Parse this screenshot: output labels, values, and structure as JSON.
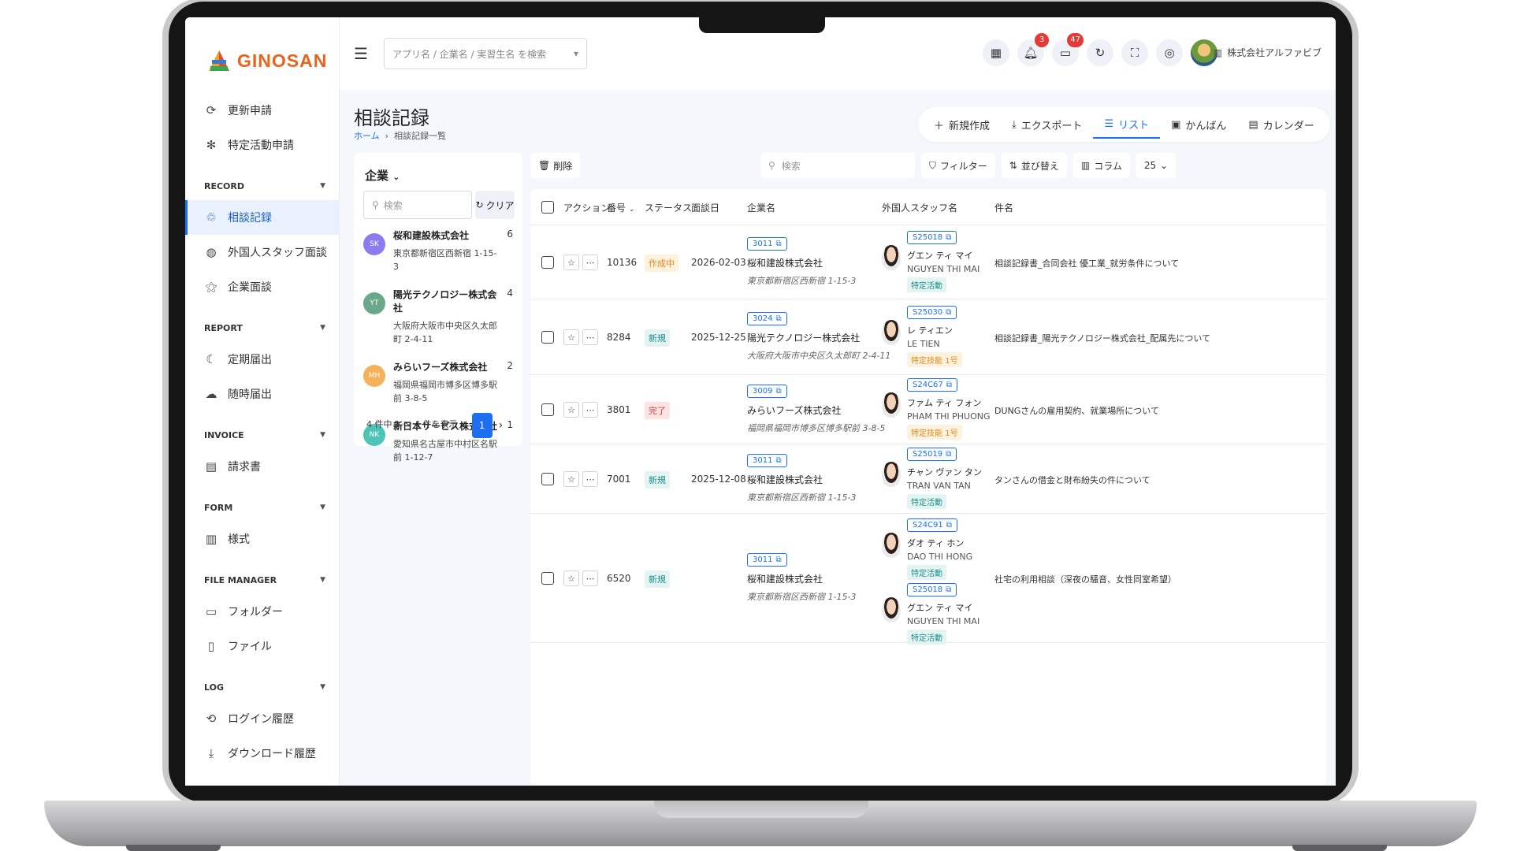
{
  "app": {
    "logo_text": "GINOSAN"
  },
  "sidebar": {
    "top_items": [
      {
        "label": "更新申請",
        "icon": "refresh-icon"
      },
      {
        "label": "特定活動申請",
        "icon": "snowflake-icon"
      }
    ],
    "sections": [
      {
        "title": "RECORD",
        "items": [
          {
            "label": "相談記録",
            "icon": "recycle-icon",
            "active": true
          },
          {
            "label": "外国人スタッフ面談",
            "icon": "globe-icon"
          },
          {
            "label": "企業面談",
            "icon": "wand-icon"
          }
        ]
      },
      {
        "title": "REPORT",
        "items": [
          {
            "label": "定期届出",
            "icon": "moon-icon"
          },
          {
            "label": "随時届出",
            "icon": "cloud-icon"
          }
        ]
      },
      {
        "title": "INVOICE",
        "items": [
          {
            "label": "請求書",
            "icon": "invoice-icon"
          }
        ]
      },
      {
        "title": "FORM",
        "items": [
          {
            "label": "様式",
            "icon": "form-icon"
          }
        ]
      },
      {
        "title": "FILE MANAGER",
        "items": [
          {
            "label": "フォルダー",
            "icon": "folder-icon"
          },
          {
            "label": "ファイル",
            "icon": "file-icon"
          }
        ]
      },
      {
        "title": "LOG",
        "items": [
          {
            "label": "ログイン履歴",
            "icon": "history-icon"
          },
          {
            "label": "ダウンロード履歴",
            "icon": "download-icon"
          }
        ]
      }
    ]
  },
  "topbar": {
    "search_placeholder": "アプリ名 / 企業名 / 実習生名 を検索",
    "notifications": "3",
    "messages": "47",
    "company_name": "株式会社アルファビブ"
  },
  "page": {
    "title": "相談記録",
    "breadcrumb_home": "ホーム",
    "breadcrumb_current": "相談記録一覧",
    "actions": {
      "new": "新規作成",
      "export": "エクスポート",
      "list": "リスト",
      "kanban": "かんばん",
      "calendar": "カレンダー"
    }
  },
  "company_panel": {
    "title": "企業",
    "search_placeholder": "検索",
    "clear_label": "クリア",
    "companies": [
      {
        "initials": "SK",
        "name": "桜和建設株式会社",
        "address": "東京都新宿区西新宿 1-15-3",
        "count": "6",
        "color": "#8a7cf0"
      },
      {
        "initials": "YT",
        "name": "陽光テクノロジー株式会社",
        "address": "大阪府大阪市中央区久太郎町 2-4-11",
        "count": "4",
        "color": "#6aa889"
      },
      {
        "initials": "MH",
        "name": "みらいフーズ株式会社",
        "address": "福岡県福岡市博多区博多駅前 3-8-5",
        "count": "2",
        "color": "#f5b25a"
      },
      {
        "initials": "NK",
        "name": "新日本サービス株式会社",
        "address": "愛知県名古屋市中村区名駅前 1-12-7",
        "count": "1",
        "color": "#4ec3b8"
      }
    ],
    "pager_text": "4 件中 1 ～ 4 件を表示",
    "current_page": "1"
  },
  "toolbar": {
    "delete_label": "削除",
    "search_placeholder": "検索",
    "filter_label": "フィルター",
    "sort_label": "並び替え",
    "column_label": "コラム",
    "page_size": "25"
  },
  "table": {
    "headers": {
      "action": "アクション",
      "number": "番号",
      "status": "ステータス",
      "date": "面談日",
      "company": "企業名",
      "staff": "外国人スタッフ名",
      "subject": "件名"
    },
    "rows": [
      {
        "number": "10136",
        "status": "作成中",
        "status_kind": "draft",
        "date": "2026-02-03",
        "company_code": "3011",
        "company": "桜和建設株式会社",
        "address": "東京都新宿区西新宿 1-15-3",
        "staff": [
          {
            "code": "S25018",
            "name": "グエン ティ マイ",
            "roman": "NGUYEN THI MAI",
            "visa": "特定活動",
            "visa_kind": "spec"
          }
        ],
        "subject": "相談記録書_合同会社 優工業_就労条件について"
      },
      {
        "number": "8284",
        "status": "新規",
        "status_kind": "new",
        "date": "2025-12-25",
        "company_code": "3024",
        "company": "陽光テクノロジー株式会社",
        "address": "大阪府大阪市中央区久太郎町 2-4-11",
        "staff": [
          {
            "code": "S25030",
            "name": "レ ティエン",
            "roman": "LE TIEN",
            "visa": "特定技能 1号",
            "visa_kind": "skill"
          }
        ],
        "subject": "相談記録書_陽光テクノロジー株式会社_配属先について"
      },
      {
        "number": "3801",
        "status": "完了",
        "status_kind": "done",
        "date": "",
        "company_code": "3009",
        "company": "みらいフーズ株式会社",
        "address": "福岡県福岡市博多区博多駅前 3-8-5",
        "staff": [
          {
            "code": "S24C67",
            "name": "ファム ティ フォン",
            "roman": "PHAM THI PHUONG",
            "visa": "特定技能 1号",
            "visa_kind": "skill"
          }
        ],
        "subject": "DUNGさんの雇用契約、就業場所について"
      },
      {
        "number": "7001",
        "status": "新規",
        "status_kind": "new",
        "date": "2025-12-08",
        "company_code": "3011",
        "company": "桜和建設株式会社",
        "address": "東京都新宿区西新宿 1-15-3",
        "staff": [
          {
            "code": "S25019",
            "name": "チャン ヴァン タン",
            "roman": "TRAN VAN TAN",
            "visa": "特定活動",
            "visa_kind": "spec"
          }
        ],
        "subject": "タンさんの借金と財布紛失の件について"
      },
      {
        "number": "6520",
        "status": "新規",
        "status_kind": "new",
        "date": "",
        "company_code": "3011",
        "company": "桜和建設株式会社",
        "address": "東京都新宿区西新宿 1-15-3",
        "staff": [
          {
            "code": "S24C91",
            "name": "ダオ ティ ホン",
            "roman": "DAO THI HONG",
            "visa": "特定活動",
            "visa_kind": "spec"
          },
          {
            "code": "S25018",
            "name": "グエン ティ マイ",
            "roman": "NGUYEN THI MAI",
            "visa": "特定活動",
            "visa_kind": "spec"
          }
        ],
        "subject": "社宅の利用相談（深夜の騒音、女性同室希望）"
      }
    ]
  }
}
